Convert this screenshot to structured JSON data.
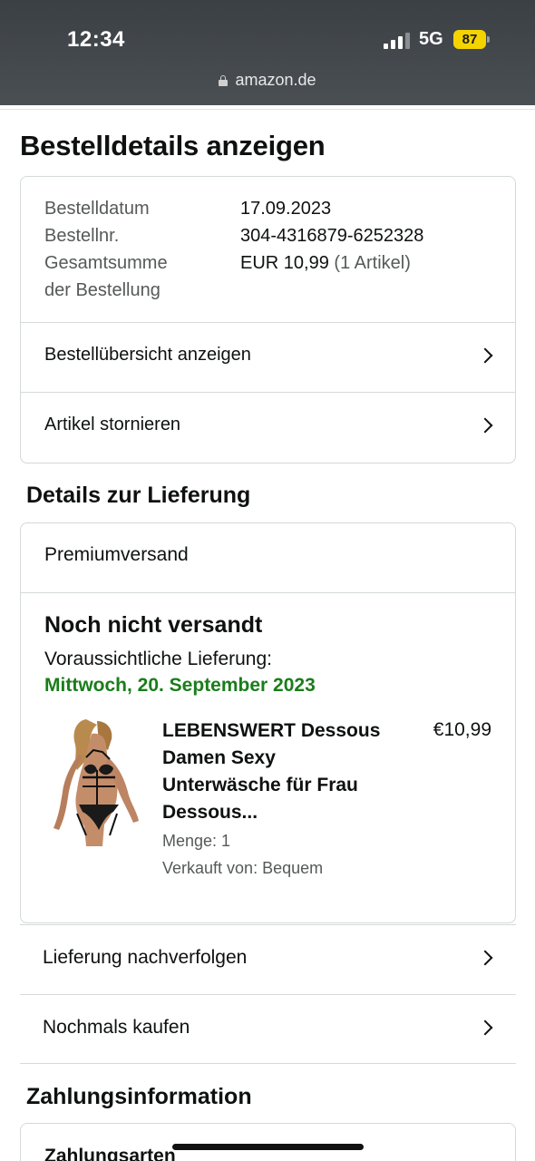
{
  "status_bar": {
    "time": "12:34",
    "network": "5G",
    "battery": "87",
    "url": "amazon.de"
  },
  "page_title": "Bestelldetails anzeigen",
  "order_summary": {
    "date_label": "Bestelldatum",
    "date_value": "17.09.2023",
    "number_label": "Bestellnr.",
    "number_value": "304-4316879-6252328",
    "total_label_line1": "Gesamtsumme",
    "total_label_line2": "der Bestellung",
    "total_value": "EUR 10,99",
    "total_items": "(1 Artikel)",
    "rows": [
      {
        "label": "Bestellübersicht anzeigen"
      },
      {
        "label": "Artikel stornieren"
      }
    ]
  },
  "delivery": {
    "section_title": "Details zur Lieferung",
    "shipping_type": "Premiumversand",
    "status": "Noch nicht versandt",
    "expected_label": "Voraussichtliche Lieferung:",
    "expected_date": "Mittwoch, 20. September 2023",
    "product": {
      "title_lines": [
        "LEBENSWERT Dessous",
        "Damen Sexy",
        "Unterwäsche für Frau",
        "Dessous..."
      ],
      "price": "€10,99",
      "quantity": "Menge: 1",
      "seller": "Verkauft von: Bequem"
    },
    "actions": [
      {
        "label": "Lieferung nachverfolgen"
      },
      {
        "label": "Nochmals kaufen"
      }
    ]
  },
  "payment": {
    "section_title": "Zahlungsinformation",
    "methods_label": "Zahlungsarten"
  },
  "colors": {
    "accent_green": "#1a7d1a",
    "border": "#d5d9d9",
    "battery": "#f5d300"
  }
}
